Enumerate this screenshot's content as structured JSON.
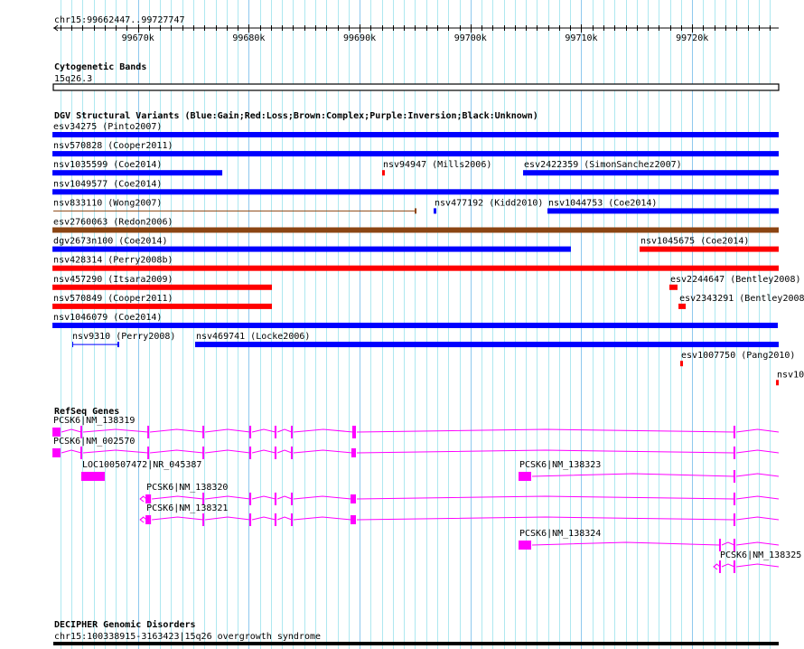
{
  "region": {
    "label": "chr15:99662447..99727747",
    "start_kb": 99662.447,
    "end_kb": 99727.747
  },
  "ruler": {
    "ticks": [
      "99670k",
      "99680k",
      "99690k",
      "99700k",
      "99710k",
      "99720k"
    ]
  },
  "colors": {
    "gain": "#0000ff",
    "loss": "#ff0000",
    "complex": "#8b4513",
    "gene": "#ff00ff",
    "grid": "#aee8f0",
    "grid_major": "#8ec8ee"
  },
  "cytoband": {
    "title": "Cytogenetic Bands",
    "label": "15q26.3"
  },
  "dgv": {
    "title": "DGV Structural Variants (Blue:Gain;Red:Loss;Brown:Complex;Purple:Inversion;Black:Unknown)",
    "rows": [
      [
        {
          "label": "esv34275 (Pinto2007)",
          "type": "gain",
          "start": 99662.37,
          "end": 99727.81
        }
      ],
      [
        {
          "label": "nsv570828 (Cooper2011)",
          "type": "gain",
          "start": 99662.37,
          "end": 99727.81
        }
      ],
      [
        {
          "label": "nsv1035599 (Coe2014)",
          "type": "gain",
          "start": 99662.37,
          "end": 99677.61
        },
        {
          "label": "nsv94947 (Mills2006)",
          "type": "loss",
          "start": 99692.11,
          "end": 99692.27
        },
        {
          "label": "esv2422359 (SimonSanchez2007)",
          "type": "gain",
          "start": 99704.83,
          "end": 99727.81
        }
      ],
      [
        {
          "label": "nsv1049577 (Coe2014)",
          "type": "gain",
          "start": 99662.37,
          "end": 99727.81
        }
      ],
      [
        {
          "label": "nsv833110 (Wong2007)",
          "type": "complex",
          "thin": true,
          "start": 99662.37,
          "end": 99695.13
        },
        {
          "label": "nsv477192 (Kidd2010)",
          "type": "gain",
          "start": 99696.76,
          "end": 99696.92
        },
        {
          "label": "nsv1044753 (Coe2014)",
          "type": "gain",
          "start": 99707.03,
          "end": 99727.81
        }
      ],
      [
        {
          "label": "esv2760063 (Redon2006)",
          "type": "complex",
          "start": 99662.37,
          "end": 99727.81
        }
      ],
      [
        {
          "label": "dgv2673n100 (Coe2014)",
          "type": "gain",
          "start": 99662.37,
          "end": 99709.06
        },
        {
          "label": "nsv1045675 (Coe2014)",
          "type": "loss",
          "start": 99715.34,
          "end": 99727.81
        }
      ],
      [
        {
          "label": "nsv428314 (Perry2008b)",
          "type": "loss",
          "start": 99662.37,
          "end": 99727.81
        }
      ],
      [
        {
          "label": "nsv457290 (Itsara2009)",
          "type": "loss",
          "start": 99662.37,
          "end": 99682.09
        },
        {
          "label": "esv2244647 (Bentley2008)",
          "type": "loss",
          "start": 99718.03,
          "end": 99718.68
        }
      ],
      [
        {
          "label": "nsv570849 (Cooper2011)",
          "type": "loss",
          "start": 99662.37,
          "end": 99682.09
        },
        {
          "label": "esv2343291 (Bentley2008",
          "type": "loss",
          "start": 99718.85,
          "end": 99719.42
        }
      ],
      [
        {
          "label": "nsv1046079 (Coe2014)",
          "type": "gain",
          "start": 99662.37,
          "end": 99727.73
        }
      ],
      [
        {
          "label": "nsv9310 (Perry2008)",
          "type": "gain",
          "thin": true,
          "start": 99664.08,
          "end": 99668.31
        },
        {
          "label": "nsv469741 (Locke2006)",
          "type": "gain",
          "start": 99675.24,
          "end": 99727.81
        }
      ],
      [
        {
          "label": "esv1007750 (Pang2010)",
          "type": "loss",
          "start": 99719.01,
          "end": 99719.17
        }
      ],
      [
        {
          "label": "nsv10",
          "type": "loss",
          "start": 99727.65,
          "end": 99727.81
        }
      ]
    ]
  },
  "refseq": {
    "title": "RefSeq Genes",
    "transcripts": [
      {
        "label": "PCSK6|NM_138319",
        "row": 0,
        "start": 99662.37,
        "end": 99727.81,
        "arrow": false,
        "exons": [
          [
            99662.37,
            99663.1
          ],
          [
            99664.89,
            99665.05
          ],
          [
            99670.93,
            99671.09
          ],
          [
            99675.9,
            99676.06
          ],
          [
            99680.13,
            99680.3
          ],
          [
            99682.41,
            99682.58
          ],
          [
            99683.88,
            99684.04
          ],
          [
            99689.42,
            99689.75
          ],
          [
            99723.81,
            99723.98
          ]
        ]
      },
      {
        "label": "PCSK6|NM_002570",
        "row": 1,
        "start": 99662.37,
        "end": 99727.81,
        "arrow": false,
        "exons": [
          [
            99662.37,
            99663.1
          ],
          [
            99664.89,
            99665.05
          ],
          [
            99670.93,
            99671.09
          ],
          [
            99675.9,
            99676.06
          ],
          [
            99680.13,
            99680.3
          ],
          [
            99682.41,
            99682.58
          ],
          [
            99683.88,
            99684.04
          ],
          [
            99689.34,
            99689.75
          ],
          [
            99723.81,
            99723.98
          ]
        ]
      },
      {
        "label": "LOC100507472|NR_045387",
        "row": 2,
        "start": 99664.97,
        "end": 99667.09,
        "arrow": false,
        "exons": [
          [
            99664.97,
            99667.09
          ]
        ]
      },
      {
        "label": "PCSK6|NM_138320",
        "row": 3,
        "start": 99670.2,
        "end": 99727.81,
        "arrow": true,
        "exons": [
          [
            99670.77,
            99671.26
          ],
          [
            99675.9,
            99676.06
          ],
          [
            99680.13,
            99680.3
          ],
          [
            99682.41,
            99682.58
          ],
          [
            99683.88,
            99684.04
          ],
          [
            99689.26,
            99689.75
          ],
          [
            99723.81,
            99723.98
          ]
        ]
      },
      {
        "label": "PCSK6|NM_138321",
        "row": 4,
        "start": 99670.2,
        "end": 99727.81,
        "arrow": true,
        "exons": [
          [
            99670.77,
            99671.26
          ],
          [
            99675.9,
            99676.06
          ],
          [
            99680.13,
            99680.3
          ],
          [
            99682.41,
            99682.58
          ],
          [
            99683.88,
            99684.04
          ],
          [
            99689.26,
            99689.75
          ],
          [
            99723.81,
            99723.98
          ]
        ]
      },
      {
        "label": "PCSK6|NM_138323",
        "row": 2,
        "start": 99704.42,
        "end": 99727.81,
        "arrow": false,
        "exons": [
          [
            99704.42,
            99705.56
          ],
          [
            99723.81,
            99723.98
          ]
        ]
      },
      {
        "label": "PCSK6|NM_138324",
        "row": 5,
        "start": 99704.42,
        "end": 99727.81,
        "arrow": false,
        "exons": [
          [
            99704.42,
            99705.56
          ],
          [
            99722.51,
            99722.67
          ],
          [
            99723.81,
            99723.98
          ]
        ]
      },
      {
        "label": "PCSK6|NM_138325",
        "row": 6,
        "start": 99721.94,
        "end": 99727.81,
        "arrow": true,
        "exons": [
          [
            99722.51,
            99722.67
          ],
          [
            99723.81,
            99723.98
          ]
        ]
      }
    ]
  },
  "decipher": {
    "title": "DECIPHER Genomic Disorders",
    "label": "chr15:100338915-3163423|15q26 overgrowth syndrome"
  }
}
